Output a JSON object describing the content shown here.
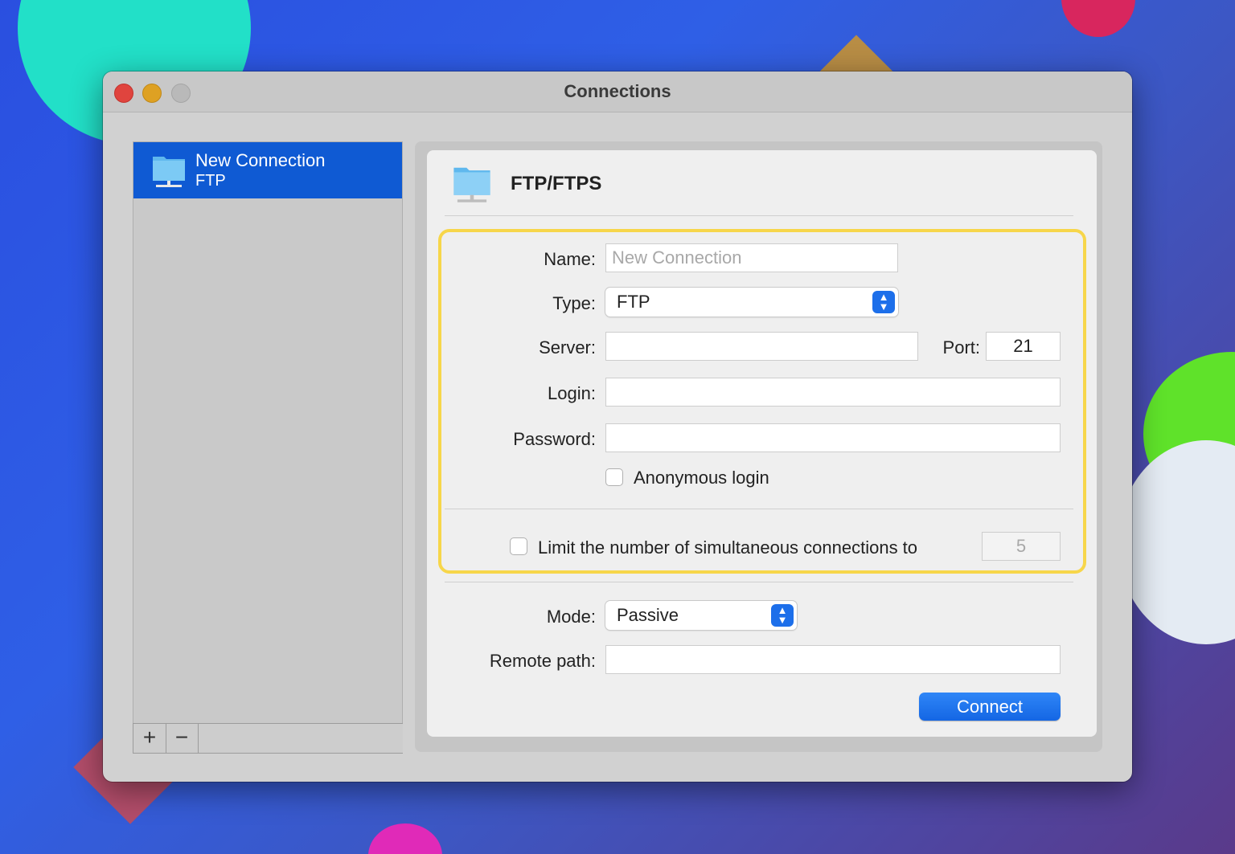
{
  "window": {
    "title": "Connections"
  },
  "sidebar": {
    "items": [
      {
        "label": "New Connection",
        "subtitle": "FTP"
      }
    ],
    "add_label": "+",
    "remove_label": "−"
  },
  "panel": {
    "title": "FTP/FTPS",
    "name": {
      "label": "Name:",
      "placeholder": "New Connection",
      "value": ""
    },
    "type": {
      "label": "Type:",
      "value": "FTP"
    },
    "server": {
      "label": "Server:",
      "value": ""
    },
    "port": {
      "label": "Port:",
      "value": "21"
    },
    "login": {
      "label": "Login:",
      "value": ""
    },
    "password": {
      "label": "Password:",
      "value": ""
    },
    "anonymous": {
      "label": "Anonymous login",
      "checked": false
    },
    "limit": {
      "label": "Limit the number of simultaneous connections to",
      "checked": false,
      "value": "5"
    },
    "mode": {
      "label": "Mode:",
      "value": "Passive"
    },
    "remote_path": {
      "label": "Remote path:",
      "value": ""
    },
    "connect_label": "Connect"
  },
  "colors": {
    "accent": "#1466e4",
    "selection": "#0f5ad3",
    "highlight": "#f7d64a"
  }
}
